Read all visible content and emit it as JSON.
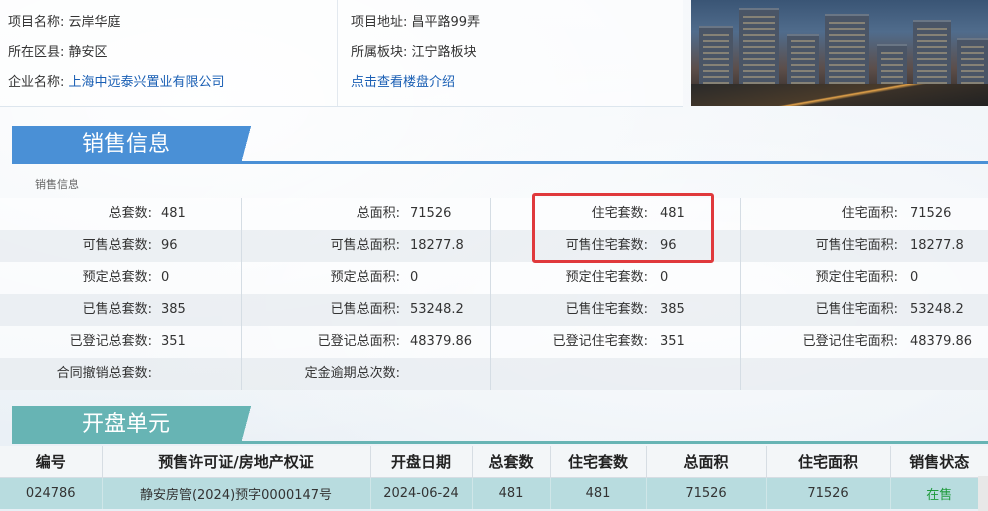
{
  "project": {
    "name_label": "项目名称:",
    "name": "云岸华庭",
    "district_label": "所在区县:",
    "district": "静安区",
    "company_label": "企业名称:",
    "company": "上海中远泰兴置业有限公司",
    "address_label": "项目地址:",
    "address": "昌平路99弄",
    "block_label": "所属板块:",
    "block": "江宁路板块",
    "intro_link": "点击查看楼盘介绍"
  },
  "sales_section": {
    "title": "销售信息",
    "subtitle": "销售信息",
    "rows": [
      [
        {
          "l": "总套数:",
          "v": "481"
        },
        {
          "l": "总面积:",
          "v": "71526"
        },
        {
          "l": "住宅套数:",
          "v": "481"
        },
        {
          "l": "住宅面积:",
          "v": "71526"
        }
      ],
      [
        {
          "l": "可售总套数:",
          "v": "96"
        },
        {
          "l": "可售总面积:",
          "v": "18277.8"
        },
        {
          "l": "可售住宅套数:",
          "v": "96"
        },
        {
          "l": "可售住宅面积:",
          "v": "18277.8"
        }
      ],
      [
        {
          "l": "预定总套数:",
          "v": "0"
        },
        {
          "l": "预定总面积:",
          "v": "0"
        },
        {
          "l": "预定住宅套数:",
          "v": "0"
        },
        {
          "l": "预定住宅面积:",
          "v": "0"
        }
      ],
      [
        {
          "l": "已售总套数:",
          "v": "385"
        },
        {
          "l": "已售总面积:",
          "v": "53248.2"
        },
        {
          "l": "已售住宅套数:",
          "v": "385"
        },
        {
          "l": "已售住宅面积:",
          "v": "53248.2"
        }
      ],
      [
        {
          "l": "已登记总套数:",
          "v": "351"
        },
        {
          "l": "已登记总面积:",
          "v": "48379.86"
        },
        {
          "l": "已登记住宅套数:",
          "v": "351"
        },
        {
          "l": "已登记住宅面积:",
          "v": "48379.86"
        }
      ],
      [
        {
          "l": "合同撤销总套数:",
          "v": ""
        },
        {
          "l": "定金逾期总次数:",
          "v": ""
        },
        {
          "l": "",
          "v": ""
        },
        {
          "l": "",
          "v": ""
        }
      ]
    ]
  },
  "open_section": {
    "title": "开盘单元",
    "headers": [
      "编号",
      "预售许可证/房地产权证",
      "开盘日期",
      "总套数",
      "住宅套数",
      "总面积",
      "住宅面积",
      "销售状态"
    ],
    "row": [
      "024786",
      "静安房管(2024)预字0000147号",
      "2024-06-24",
      "481",
      "481",
      "71526",
      "71526",
      "在售"
    ]
  },
  "colors": {
    "sales_tab": "#4a90d6",
    "open_tab": "#67b4b4",
    "highlight": "#e0393c",
    "status_green": "#1f9a3c",
    "link": "#1a5fb4"
  }
}
